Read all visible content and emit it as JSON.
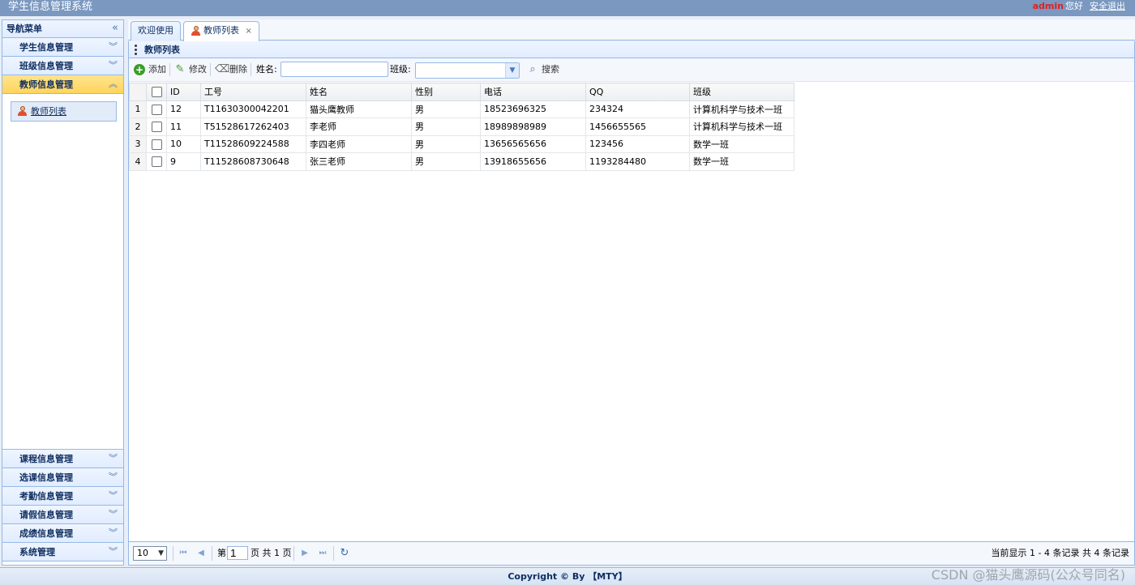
{
  "header": {
    "app_title": "学生信息管理系统",
    "user": "admin",
    "greeting": "您好",
    "logout": "安全退出"
  },
  "sidebar": {
    "title": "导航菜单",
    "collapse_icon": "double-chevron-left-icon",
    "top_items": [
      {
        "label": "学生信息管理"
      },
      {
        "label": "班级信息管理"
      },
      {
        "label": "教师信息管理",
        "active": true
      }
    ],
    "active_sub_item": {
      "label": "教师列表",
      "icon": "person-icon"
    },
    "bottom_items": [
      {
        "label": "课程信息管理"
      },
      {
        "label": "选课信息管理"
      },
      {
        "label": "考勤信息管理"
      },
      {
        "label": "请假信息管理"
      },
      {
        "label": "成绩信息管理"
      },
      {
        "label": "系统管理"
      }
    ]
  },
  "tabs": [
    {
      "label": "欢迎使用"
    },
    {
      "label": "教师列表",
      "selected": true,
      "closable": true,
      "close": "×"
    }
  ],
  "panel": {
    "title": "教师列表"
  },
  "toolbar": {
    "add_label": "添加",
    "edit_label": "修改",
    "delete_label": "删除",
    "name_label": "姓名:",
    "name_value": "",
    "class_label": "班级:",
    "class_value": "",
    "search_label": "搜索"
  },
  "table": {
    "columns": [
      "ID",
      "工号",
      "姓名",
      "性别",
      "电话",
      "QQ",
      "班级"
    ],
    "rows": [
      {
        "num": "1",
        "id": "12",
        "job_no": "T11630300042201",
        "name": "猫头鹰教师",
        "gender": "男",
        "phone": "18523696325",
        "qq": "234324",
        "class": "计算机科学与技术一班"
      },
      {
        "num": "2",
        "id": "11",
        "job_no": "T51528617262403",
        "name": "李老师",
        "gender": "男",
        "phone": "18989898989",
        "qq": "1456655565",
        "class": "计算机科学与技术一班"
      },
      {
        "num": "3",
        "id": "10",
        "job_no": "T11528609224588",
        "name": "李四老师",
        "gender": "男",
        "phone": "13656565656",
        "qq": "123456",
        "class": "数学一班"
      },
      {
        "num": "4",
        "id": "9",
        "job_no": "T11528608730648",
        "name": "张三老师",
        "gender": "男",
        "phone": "13918655656",
        "qq": "1193284480",
        "class": "数学一班"
      }
    ]
  },
  "pager": {
    "page_size": "10",
    "page_prefix": "第",
    "current_page": "1",
    "page_suffix": "页 共 1 页",
    "info": "当前显示 1 - 4 条记录 共 4 条记录"
  },
  "footer": {
    "copyright": "Copyright © By 【MTY】",
    "watermark": "CSDN @猫头鹰源码(公众号同名)"
  },
  "colors": {
    "header_bg": "#7a98c0",
    "border": "#95b8e7",
    "active_menu": "#ffd45c",
    "admin": "#e02020"
  }
}
